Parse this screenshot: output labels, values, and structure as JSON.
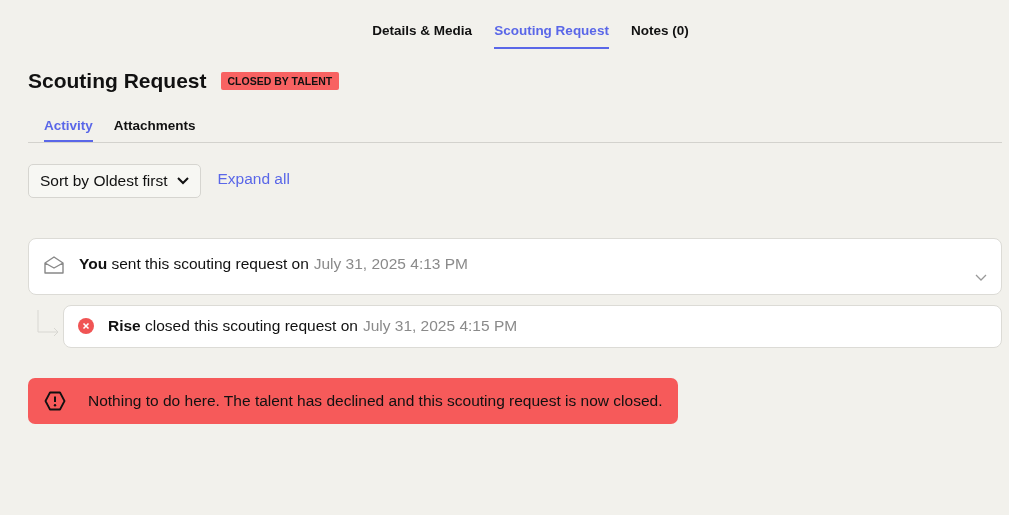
{
  "top_tabs": [
    {
      "label": "Details & Media",
      "selected": false
    },
    {
      "label": "Scouting Request",
      "selected": true
    },
    {
      "label": "Notes (0)",
      "selected": false
    }
  ],
  "heading": {
    "title": "Scouting Request",
    "status_badge": "CLOSED BY TALENT"
  },
  "sub_tabs": [
    {
      "label": "Activity",
      "selected": true
    },
    {
      "label": "Attachments",
      "selected": false
    }
  ],
  "sort_select": {
    "value": "Sort by Oldest first"
  },
  "expand_link": "Expand all",
  "activity": [
    {
      "kind": "sent",
      "text": "**You** sent this scouting request on",
      "time": "July 31, 2025 4:13 PM",
      "expanded": false,
      "children": [
        {
          "kind": "closed",
          "text": "**Rise** closed this scouting request on",
          "time": "July 31, 2025 4:15 PM"
        }
      ]
    }
  ],
  "alert": {
    "message": "Nothing to do here. The talent has declined and this scouting request is now closed."
  }
}
